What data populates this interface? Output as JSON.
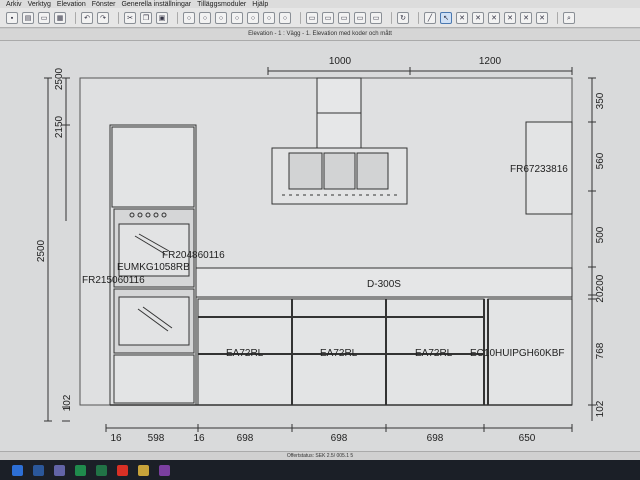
{
  "menu": [
    "Arkiv",
    "Verktyg",
    "Elevation",
    "Fönster",
    "Generella inställningar",
    "Tilläggsmoduler",
    "Hjälp"
  ],
  "window_title": "Elevation - 1 : Vägg - 1. Elevation med koder och mått",
  "status_text": "Offertstatus: SEK 2.5/ 005.1 5",
  "dims_top": [
    "1000",
    "1200"
  ],
  "dims_left_top": [
    "2500",
    "2150"
  ],
  "dims_left_main": "2500",
  "dims_left_bottom": "102",
  "dims_right": [
    "350",
    "560",
    "500",
    "200",
    "20",
    "768",
    "102"
  ],
  "dims_bottom": [
    "16",
    "598",
    "16",
    "698",
    "698",
    "698",
    "650"
  ],
  "labels": {
    "fr204860116": "FR204860116",
    "eumkg": "EUMKG1058RB",
    "fr215060116": "FR215060116",
    "fr67233816": "FR67233816",
    "d300s": "D-300S",
    "ea72rl_1": "EA72RL",
    "ea72rl_2": "EA72RL",
    "ea72rl_3": "EA72RL",
    "ec10": "EC10HUIPGH60KBF"
  }
}
